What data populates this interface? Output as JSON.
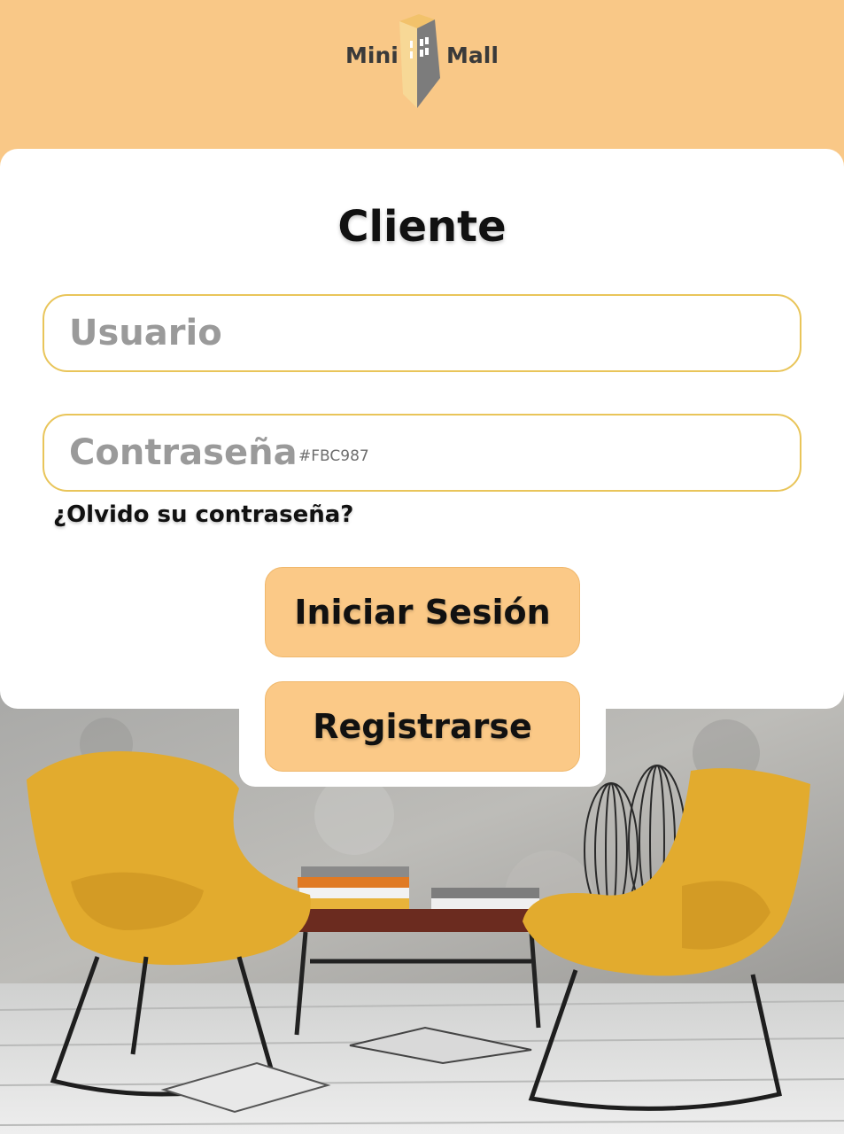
{
  "logo": {
    "left_word": "Mini",
    "right_word": "Mall"
  },
  "card": {
    "title": "Cliente"
  },
  "form": {
    "username_placeholder": "Usuario",
    "password_placeholder": "Contraseña",
    "color_note": "#FBC987",
    "forgot_link": "¿Olvido su contraseña?"
  },
  "buttons": {
    "login": "Iniciar Sesión",
    "register": "Registrarse"
  },
  "colors": {
    "accent": "#FBC987",
    "input_border": "#E9C55A",
    "card": "#FFFFFF"
  },
  "photo": {
    "subject": "two yellow lounge chairs with a coffee table and wire vases against a concrete wall"
  }
}
